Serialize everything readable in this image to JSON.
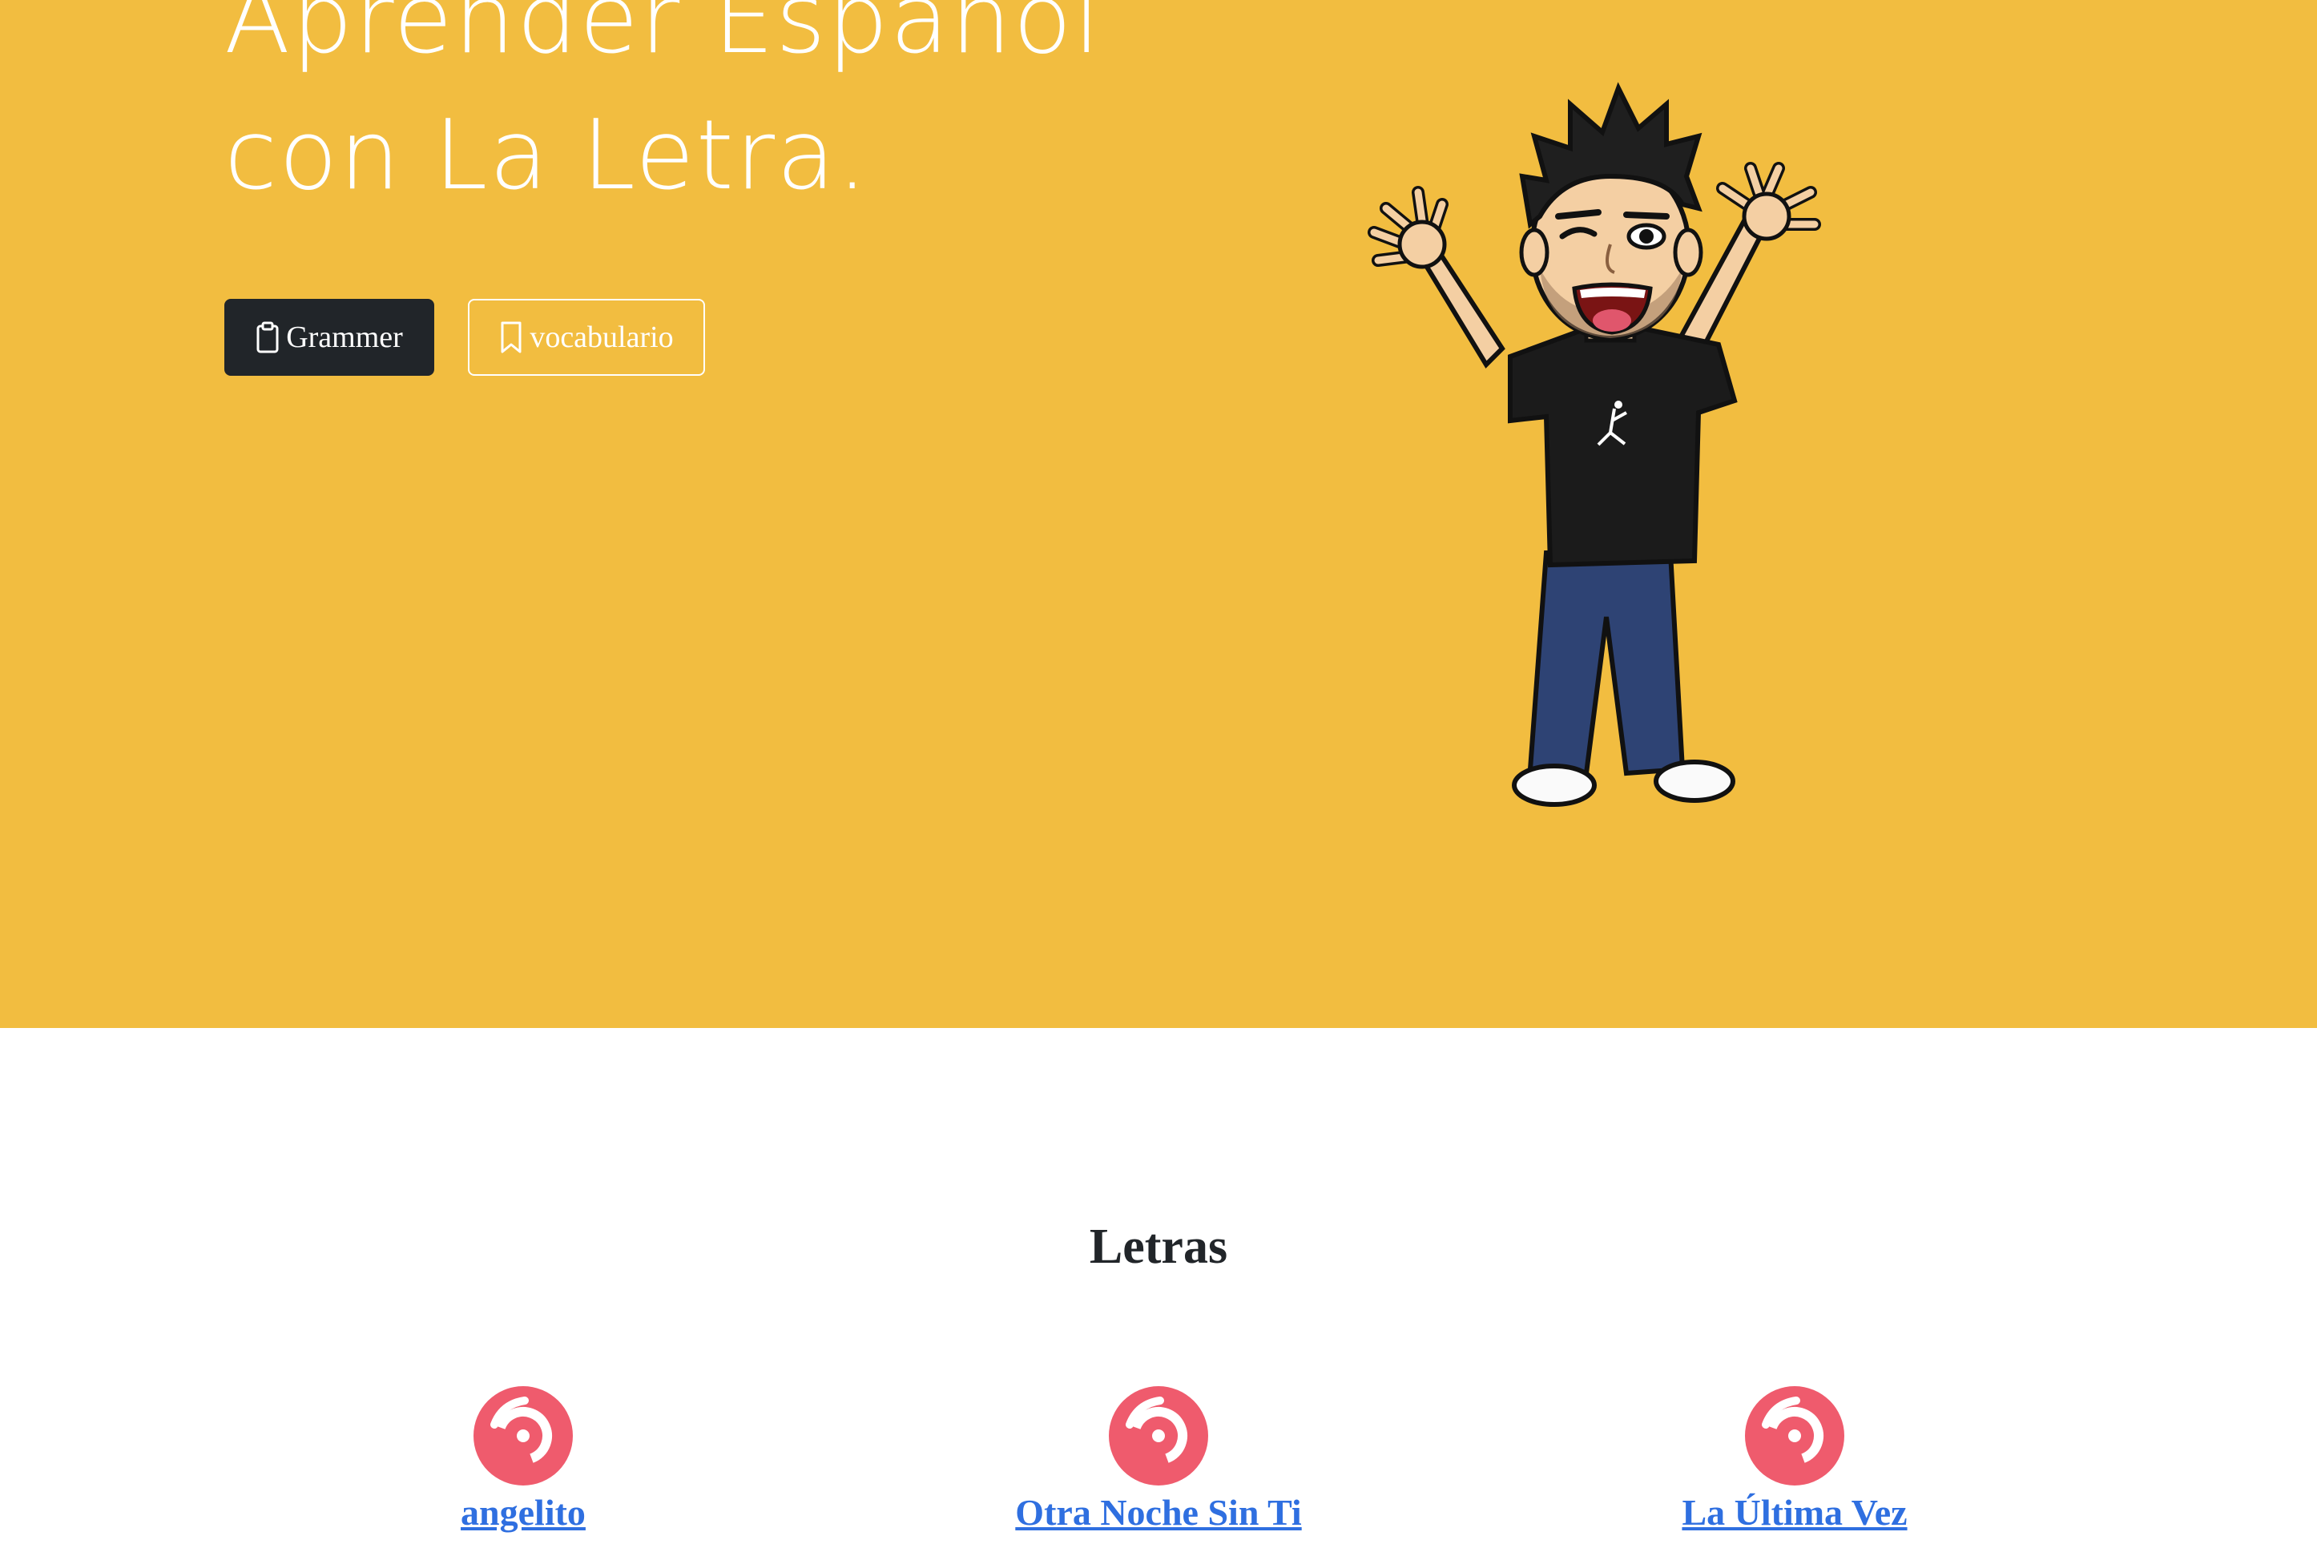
{
  "hero": {
    "title_line1": "Aprender Español",
    "title_line2": "con La Letra.",
    "buttons": [
      {
        "label": "Grammer",
        "icon": "clipboard-icon"
      },
      {
        "label": "vocabulario",
        "icon": "bookmark-icon"
      }
    ],
    "avatar_description": "waving-cartoon-avatar"
  },
  "letras": {
    "title": "Letras",
    "songs": [
      {
        "title": "angelito",
        "icon": "disc-icon"
      },
      {
        "title": "Otra Noche Sin Ti",
        "icon": "disc-icon"
      },
      {
        "title": "La Última Vez",
        "icon": "disc-icon"
      }
    ]
  },
  "colors": {
    "hero_bg": "#f2bd40",
    "dark_button": "#212529",
    "disc_icon": "#ef5b6d",
    "link": "#2f6fe0"
  }
}
